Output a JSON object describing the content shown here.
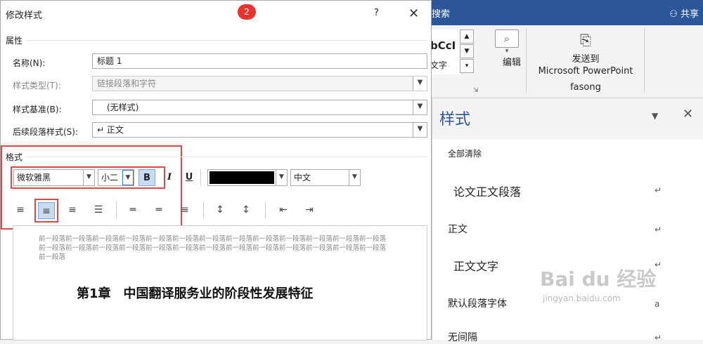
{
  "ribbon": {
    "search_label": "搜索",
    "share_label": "共享",
    "style_preview_1": "bCcI",
    "style_preview_2": "文字",
    "edit_label": "编辑",
    "send_label_1": "发送到",
    "send_label_2": "Microsoft PowerPoint",
    "send_group": "fasong"
  },
  "styles_pane": {
    "title": "样式",
    "items": [
      {
        "label": "全部清除"
      },
      {
        "label": "论文正文段落"
      },
      {
        "label": "正文"
      },
      {
        "label": "正文文字"
      },
      {
        "label": "默认段落字体"
      },
      {
        "label": "无间隔"
      }
    ]
  },
  "watermark": {
    "text": "Bai du 经验",
    "url": "jingyan.baidu.com"
  },
  "dialog": {
    "title": "修改样式",
    "badge": "2",
    "help": "?",
    "properties_section": "属性",
    "name_label": "名称(N):",
    "name_value": "标题 1",
    "style_type_label": "样式类型(T):",
    "style_type_value": "链接段落和字符",
    "based_on_label": "样式基准(B):",
    "based_on_value": "(无样式)",
    "next_style_label": "后续段落样式(S):",
    "next_style_value": "↵ 正文",
    "format_section": "格式",
    "font_value": "微软雅黑",
    "size_value": "小二",
    "bold": "B",
    "italic": "I",
    "underline": "U",
    "language_value": "中文",
    "preview_prev_para": "前一段落前一段落前一段落前一段落前一段落前一段落前一段落前一段落前一段落前一段落前一段落前一段落前一段落前一段落前一段落前一段落前一段落前一段落前一段落前一段落前一段落前一段落前一段落前一段落前一段落前一段落前一段落",
    "preview_heading": "第1章　中国翻译服务业的阶段性发展特征",
    "font_color": "#000000"
  }
}
